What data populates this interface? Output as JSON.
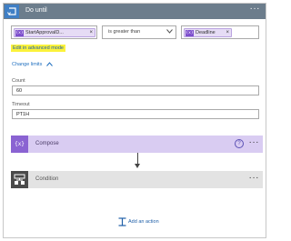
{
  "do_until": {
    "title": "Do until",
    "condition": {
      "left_token": "StartApprovalD...",
      "operator": "is greater than",
      "right_token": "Deadline",
      "token_icon": "{x}",
      "remove_symbol": "×"
    },
    "advanced_mode_link": "Edit in advanced mode",
    "change_limits_link": "Change limits",
    "count": {
      "label": "Count",
      "value": "60"
    },
    "timeout": {
      "label": "Timeout",
      "value": "PT1H"
    }
  },
  "actions": {
    "compose": {
      "title": "Compose",
      "icon": "{x}",
      "help": "?"
    },
    "condition": {
      "title": "Condition"
    }
  },
  "menu_symbol": "···",
  "add_action_label": "Add an action",
  "colors": {
    "header": "#6c7d8c",
    "loop_icon": "#3f7fc5",
    "compose_accent": "#8a63d2",
    "highlight": "#fbf23b",
    "link": "#1f5fa8"
  },
  "icons": [
    "loop-icon",
    "chevron-down-icon",
    "chevron-up-icon",
    "variable-icon",
    "help-icon",
    "more-options-icon",
    "arrow-down-icon",
    "condition-icon",
    "add-action-icon"
  ]
}
